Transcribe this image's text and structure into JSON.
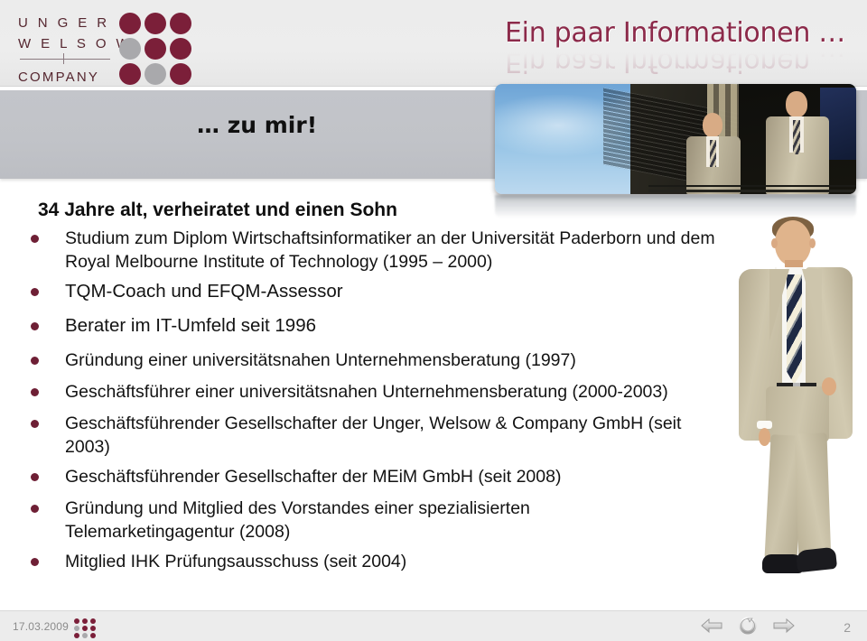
{
  "header": {
    "logo": {
      "line1": "U N G E R",
      "line2": "W E L S O W",
      "line3": "COMPANY",
      "dot_colors": [
        "#7b1f39",
        "#7b1f39",
        "#7b1f39",
        "#a9a9ac",
        "#7b1f39",
        "#7b1f39",
        "#7b1f39",
        "#a9a9ac",
        "#7b1f39"
      ]
    },
    "title": "Ein paar Informationen …",
    "accent_color": "#8c2a4a"
  },
  "subtitle": {
    "text": "… zu mir!"
  },
  "photos": {
    "top_banner_alt": "two-businessmen-on-balcony-photo",
    "person_alt": "standing-businessman-in-beige-suit-photo"
  },
  "content": {
    "lead_line": "34 Jahre alt, verheiratet und einen Sohn",
    "bullets": [
      "Studium zum Diplom Wirtschaftsinformatiker an der Universität Paderborn und dem Royal Melbourne Institute of Technology (1995 – 2000)",
      "TQM-Coach und EFQM-Assessor",
      "Berater im IT-Umfeld seit 1996",
      "Gründung einer universitätsnahen Unternehmensberatung (1997)",
      "Geschäftsführer einer universitätsnahen Unternehmensberatung (2000-2003)",
      "Geschäftsführender Gesellschafter der Unger, Welsow & Company GmbH (seit 2003)",
      "Geschäftsführender Gesellschafter der MEiM GmbH (seit 2008)",
      "Gründung und Mitglied des Vorstandes einer spezialisierten Telemarketingagentur (2008)",
      "Mitglied IHK Prüfungsausschuss (seit 2004)"
    ],
    "bullet_color": "#6e1f35"
  },
  "footer": {
    "date": "17.03.2009",
    "page_number": "2",
    "dot_colors": [
      "#7b1f39",
      "#7b1f39",
      "#7b1f39",
      "#a9a9ac",
      "#7b1f39",
      "#7b1f39",
      "#7b1f39",
      "#a9a9ac",
      "#7b1f39"
    ],
    "nav": {
      "previous": "previous-slide",
      "home": "restart-slideshow",
      "next": "next-slide"
    }
  }
}
